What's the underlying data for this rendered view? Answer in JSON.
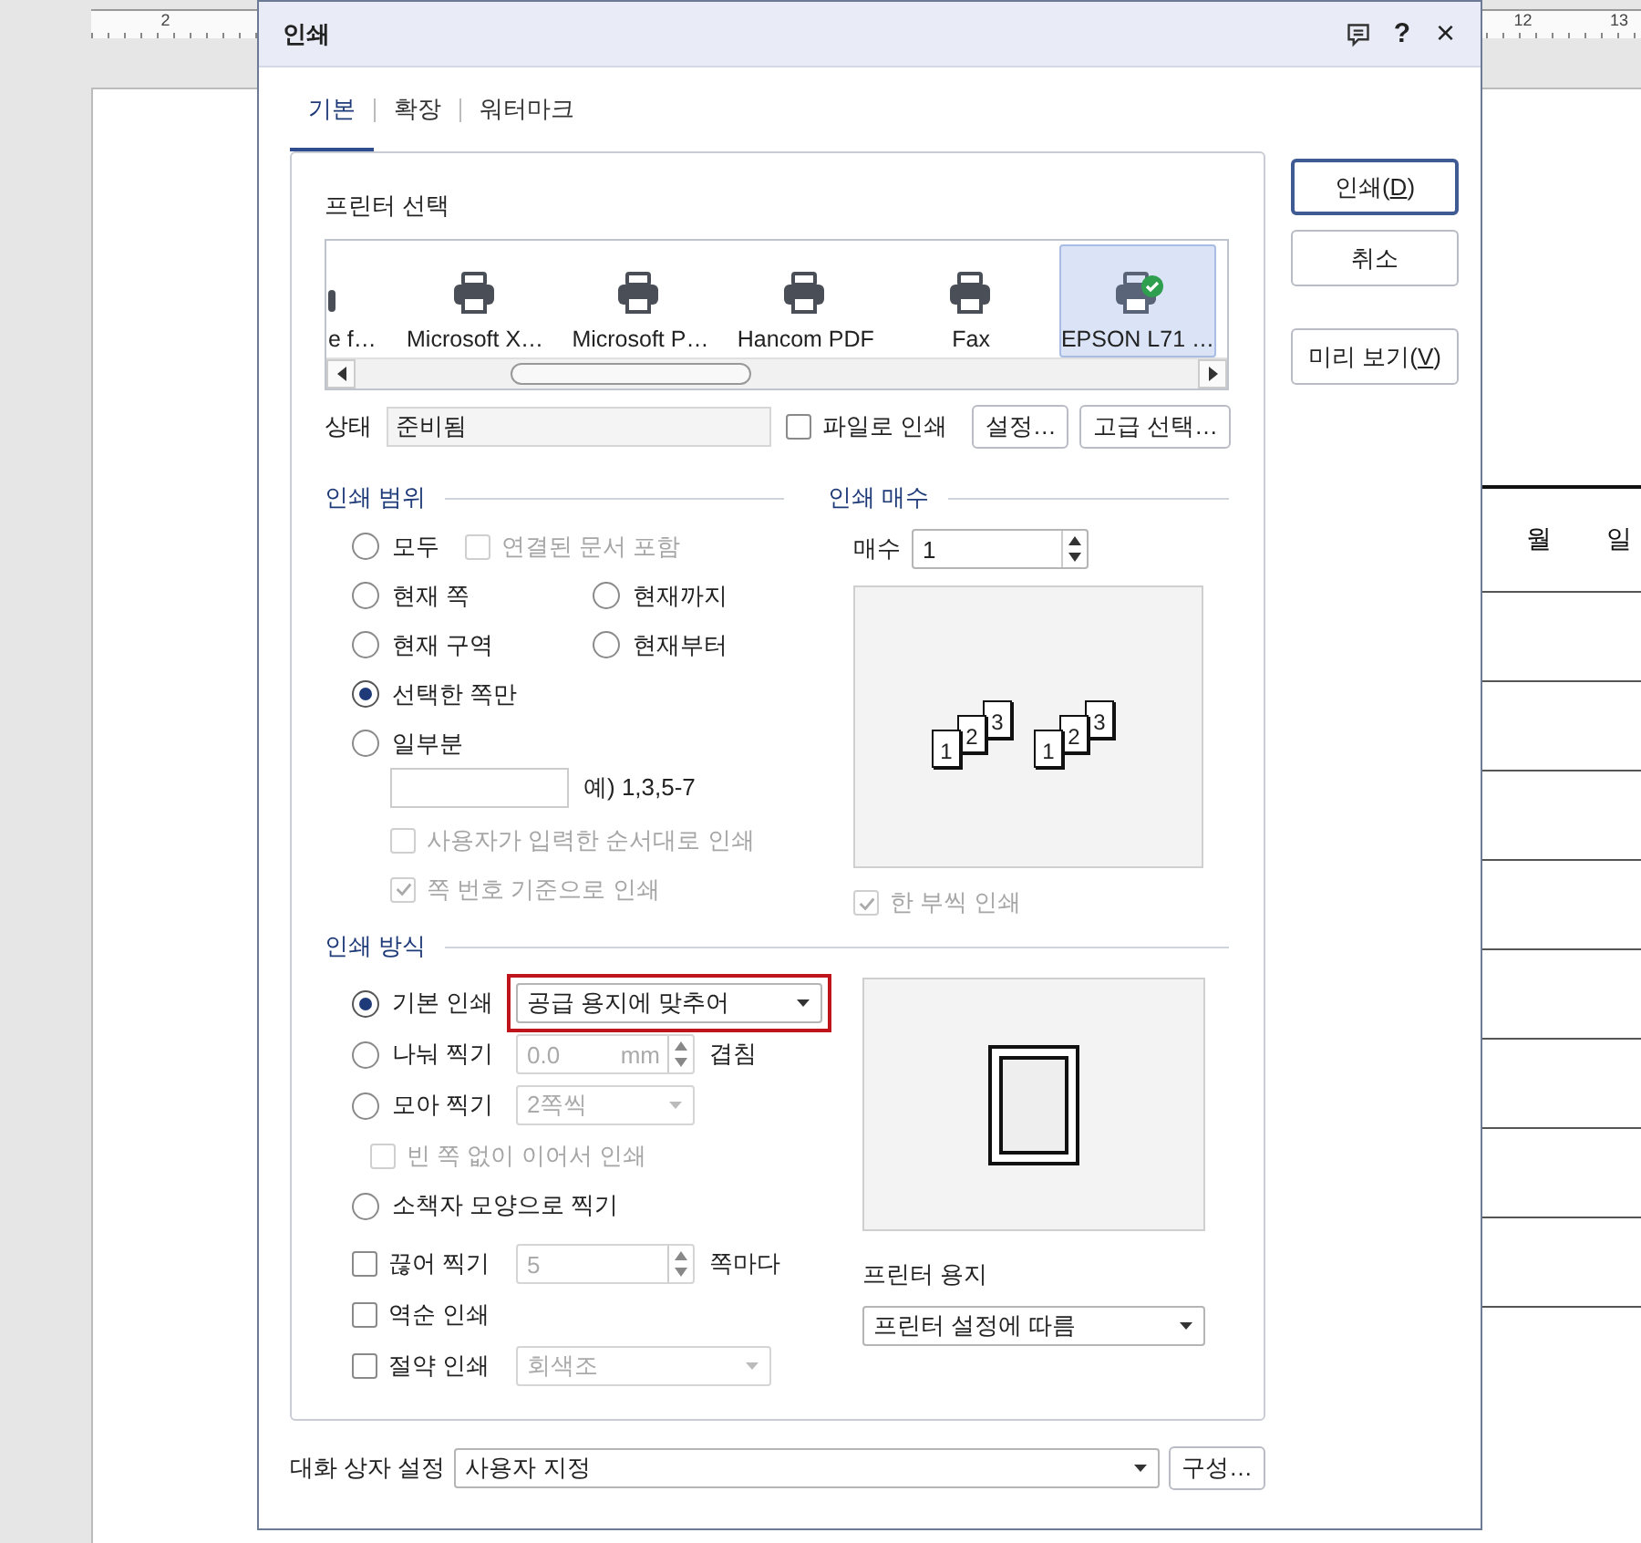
{
  "document": {
    "ruler_labels": [
      "2",
      "12",
      "13"
    ],
    "table_header": [
      "월",
      "일"
    ]
  },
  "dialog": {
    "title": "인쇄",
    "title_buttons": [
      {
        "kind": "feedback"
      },
      {
        "kind": "help",
        "label": "?"
      },
      {
        "kind": "close",
        "label": "×"
      }
    ]
  },
  "tabs": [
    {
      "label": "기본",
      "selected": true
    },
    {
      "label": "확장",
      "selected": false
    },
    {
      "label": "워터마크",
      "selected": false
    }
  ],
  "printer_select": {
    "label": "프린터 선택",
    "printers": [
      {
        "name": "e f…",
        "partial": true,
        "selected": false,
        "default": false
      },
      {
        "name": "Microsoft X…",
        "selected": false,
        "default": false
      },
      {
        "name": "Microsoft P…",
        "selected": false,
        "default": false
      },
      {
        "name": "Hancom PDF",
        "selected": false,
        "default": false
      },
      {
        "name": "Fax",
        "selected": false,
        "default": false
      },
      {
        "name": "EPSON L71 …",
        "selected": true,
        "default": true
      }
    ]
  },
  "status": {
    "label": "상태",
    "value": "준비됨",
    "print_to_file": {
      "label": "파일로 인쇄",
      "checked": false
    },
    "buttons": [
      "설정…",
      "고급 선택…"
    ]
  },
  "range": {
    "title": "인쇄 범위",
    "radios": [
      {
        "label": "모두",
        "selected": false
      },
      {
        "label": "현재 쪽",
        "selected": false
      },
      {
        "label": "현재까지",
        "selected": false
      },
      {
        "label": "현재 구역",
        "selected": false
      },
      {
        "label": "현재부터",
        "selected": false
      },
      {
        "label": "선택한 쪽만",
        "selected": true
      },
      {
        "label": "일부분",
        "selected": false
      }
    ],
    "linked_docs": {
      "label": "연결된 문서 포함",
      "checked": false,
      "disabled": true
    },
    "example": "예) 1,3,5-7",
    "options": [
      {
        "label": "사용자가 입력한 순서대로 인쇄",
        "checked": false,
        "disabled": true
      },
      {
        "label": "쪽 번호 기준으로 인쇄",
        "checked": true,
        "disabled": true
      }
    ]
  },
  "copies": {
    "title": "인쇄 매수",
    "label": "매수",
    "value": "1",
    "preview_sets": [
      [
        "1",
        "2",
        "3"
      ],
      [
        "1",
        "2",
        "3"
      ]
    ],
    "collate": {
      "label": "한 부씩 인쇄",
      "checked": true,
      "disabled": true
    }
  },
  "method": {
    "title": "인쇄 방식",
    "modes": [
      {
        "label": "기본 인쇄",
        "selected": true,
        "kind": "dropdown",
        "value": "공급 용지에 맞추어",
        "disabled": false,
        "highlighted": true
      },
      {
        "label": "나눠 찍기",
        "selected": false,
        "kind": "spinner",
        "value": "0.0",
        "unit": "mm",
        "suffix": "겹침",
        "disabled": true
      },
      {
        "label": "모아 찍기",
        "selected": false,
        "kind": "dropdown",
        "value": "2쪽씩",
        "disabled": true
      },
      {
        "label": "소책자 모양으로 찍기",
        "selected": false,
        "kind": "none"
      }
    ],
    "continuous": {
      "label": "빈 쪽 없이 이어서 인쇄",
      "checked": false,
      "disabled": true
    },
    "extras": [
      {
        "label": "끊어 찍기",
        "checked": false,
        "kind": "spinner",
        "value": "5",
        "suffix": "쪽마다",
        "disabled": true
      },
      {
        "label": "역순 인쇄",
        "checked": false,
        "kind": "none"
      },
      {
        "label": "절약 인쇄",
        "checked": false,
        "kind": "dropdown",
        "value": "회색조",
        "disabled": true
      }
    ],
    "paper": {
      "label": "프린터 용지",
      "value": "프린터 설정에 따름"
    }
  },
  "dialog_settings": {
    "label": "대화 상자 설정",
    "value": "사용자 지정",
    "button": "구성…"
  },
  "actions": [
    {
      "before": "인쇄(",
      "key": "D",
      "after": ")",
      "default": true
    },
    {
      "before": "취소",
      "default": false
    },
    {
      "before": "미리 보기(",
      "key": "V",
      "after": ")",
      "default": false
    }
  ]
}
